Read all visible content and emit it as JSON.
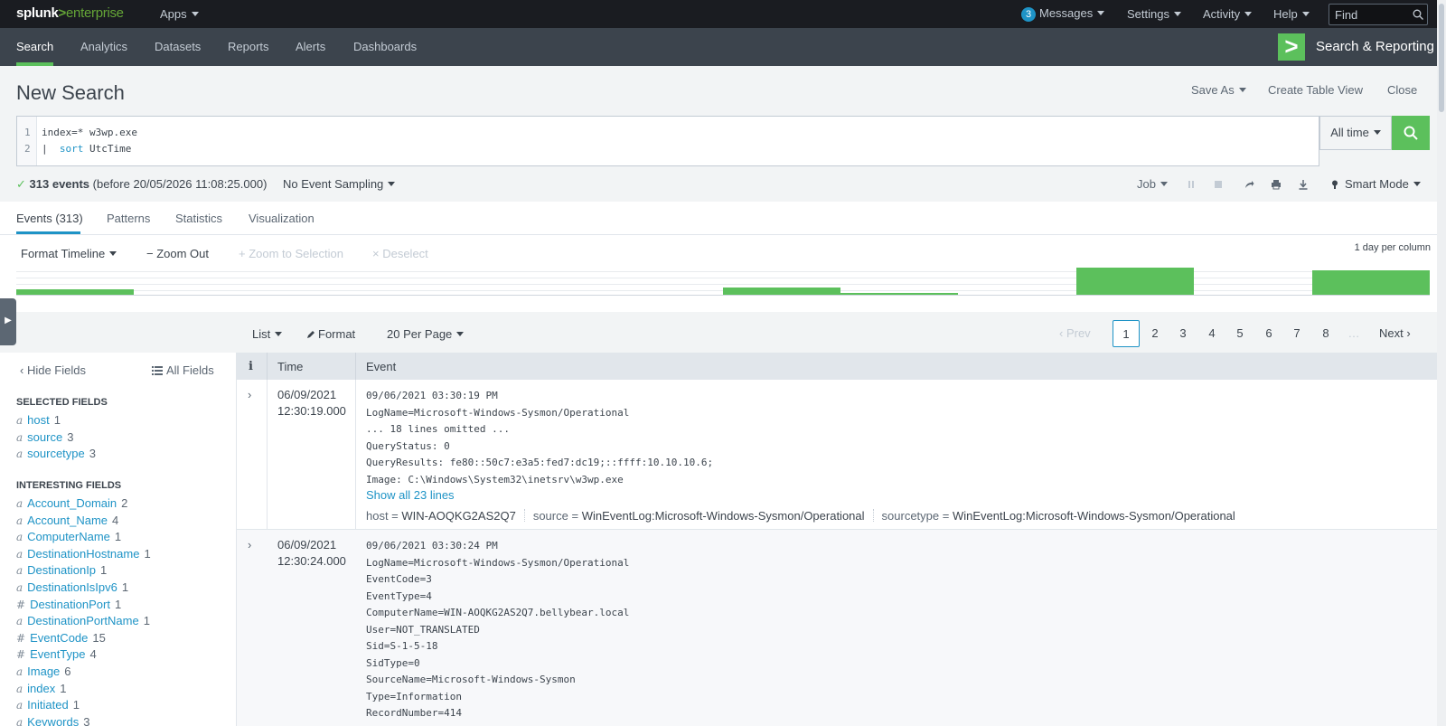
{
  "topbar": {
    "logo_prefix": "splunk",
    "logo_gt": ">",
    "logo_suffix": "enterprise",
    "apps_label": "Apps",
    "messages_count": "3",
    "messages_label": "Messages",
    "settings_label": "Settings",
    "activity_label": "Activity",
    "help_label": "Help",
    "find_placeholder": "Find"
  },
  "appnav": {
    "tabs": [
      "Search",
      "Analytics",
      "Datasets",
      "Reports",
      "Alerts",
      "Dashboards"
    ],
    "app_name": "Search & Reporting",
    "app_icon_glyph": ">"
  },
  "header": {
    "title": "New Search",
    "save_as": "Save As",
    "create_table_view": "Create Table View",
    "close": "Close"
  },
  "search": {
    "line_numbers": [
      "1",
      "2"
    ],
    "line1": "index=* w3wp.exe",
    "line2_pipe": "|",
    "line2_cmd": "sort",
    "line2_arg": "UtcTime",
    "time_range": "All time"
  },
  "job": {
    "check": "✓",
    "events_count": "313 events",
    "before": "(before 20/05/2026 11:08:25.000)",
    "sampling": "No Event Sampling",
    "job_label": "Job",
    "mode": "Smart Mode"
  },
  "result_tabs": [
    "Events (313)",
    "Patterns",
    "Statistics",
    "Visualization"
  ],
  "timeline": {
    "format_timeline": "Format Timeline",
    "zoom_out": "− Zoom Out",
    "zoom_to_selection": "+ Zoom to Selection",
    "deselect": "× Deselect",
    "scale": "1 day per column",
    "columns": 12,
    "bar_levels": [
      0.2,
      0,
      0,
      0,
      0,
      0,
      0.25,
      0.05,
      0,
      1.0,
      0,
      0.9
    ]
  },
  "list_controls": {
    "list": "List",
    "format": "Format",
    "per_page": "20 Per Page",
    "prev": "Prev",
    "pages": [
      "1",
      "2",
      "3",
      "4",
      "5",
      "6",
      "7",
      "8"
    ],
    "ellipsis": "…",
    "next": "Next",
    "current_page": "1"
  },
  "sidebar": {
    "hide_fields": "Hide Fields",
    "all_fields": "All Fields",
    "selected_header": "SELECTED FIELDS",
    "selected": [
      {
        "type": "a",
        "name": "host",
        "count": "1"
      },
      {
        "type": "a",
        "name": "source",
        "count": "3"
      },
      {
        "type": "a",
        "name": "sourcetype",
        "count": "3"
      }
    ],
    "interesting_header": "INTERESTING FIELDS",
    "interesting": [
      {
        "type": "a",
        "name": "Account_Domain",
        "count": "2"
      },
      {
        "type": "a",
        "name": "Account_Name",
        "count": "4"
      },
      {
        "type": "a",
        "name": "ComputerName",
        "count": "1"
      },
      {
        "type": "a",
        "name": "DestinationHostname",
        "count": "1"
      },
      {
        "type": "a",
        "name": "DestinationIp",
        "count": "1"
      },
      {
        "type": "a",
        "name": "DestinationIsIpv6",
        "count": "1"
      },
      {
        "type": "#",
        "name": "DestinationPort",
        "count": "1"
      },
      {
        "type": "a",
        "name": "DestinationPortName",
        "count": "1"
      },
      {
        "type": "#",
        "name": "EventCode",
        "count": "15"
      },
      {
        "type": "#",
        "name": "EventType",
        "count": "4"
      },
      {
        "type": "a",
        "name": "Image",
        "count": "6"
      },
      {
        "type": "a",
        "name": "index",
        "count": "1"
      },
      {
        "type": "a",
        "name": "Initiated",
        "count": "1"
      },
      {
        "type": "a",
        "name": "Keywords",
        "count": "3"
      }
    ]
  },
  "table": {
    "headers": [
      "i",
      "Time",
      "Event"
    ],
    "events": [
      {
        "date": "06/09/2021",
        "time": "12:30:19.000",
        "lines": [
          "09/06/2021 03:30:19 PM",
          "LogName=Microsoft-Windows-Sysmon/Operational",
          "... 18 lines omitted ...",
          "QueryStatus: 0",
          "QueryResults: fe80::50c7:e3a5:fed7:dc19;::ffff:10.10.10.6;",
          "Image: C:\\Windows\\System32\\inetsrv\\w3wp.exe"
        ],
        "show_all": "Show all 23 lines",
        "host_key": "host =",
        "host": "WIN-AOQKG2AS2Q7",
        "source_key": "source =",
        "source": "WinEventLog:Microsoft-Windows-Sysmon/Operational",
        "sourcetype_key": "sourcetype =",
        "sourcetype": "WinEventLog:Microsoft-Windows-Sysmon/Operational"
      },
      {
        "date": "06/09/2021",
        "time": "12:30:24.000",
        "lines": [
          "09/06/2021 03:30:24 PM",
          "LogName=Microsoft-Windows-Sysmon/Operational",
          "EventCode=3",
          "EventType=4",
          "ComputerName=WIN-AOQKG2AS2Q7.bellybear.local",
          "User=NOT_TRANSLATED",
          "Sid=S-1-5-18",
          "SidType=0",
          "SourceName=Microsoft-Windows-Sysmon",
          "Type=Information",
          "RecordNumber=414"
        ]
      }
    ]
  },
  "colors": {
    "accent_green": "#5cc05c",
    "link_blue": "#1e93c6",
    "topbar": "#1a1c21",
    "appnav": "#3c444d"
  }
}
